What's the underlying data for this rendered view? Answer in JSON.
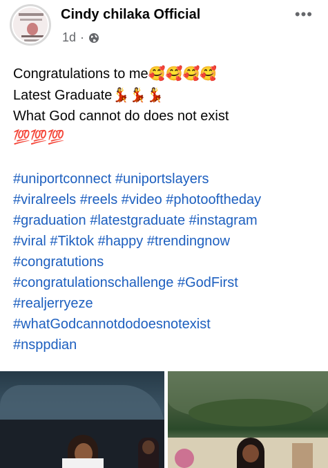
{
  "post": {
    "author": "Cindy chilaka Official",
    "time": "1d",
    "separator": "·",
    "more_label": "•••",
    "lines": [
      {
        "text": "Congratulations to me",
        "emoji": "🥰🥰🥰🥰"
      },
      {
        "text": "Latest Graduate",
        "emoji": "💃💃💃"
      },
      {
        "text": "What God cannot do does not exist",
        "emoji": ""
      },
      {
        "text": "",
        "emoji": "💯💯💯"
      }
    ],
    "hashtags": [
      [
        "#uniportconnect",
        "#uniportslayers"
      ],
      [
        "#viralreels",
        "#reels",
        "#video",
        "#photooftheday"
      ],
      [
        "#graduation",
        "#latestgraduate",
        "#instagram"
      ],
      [
        "#viral",
        "#Tiktok",
        "#happy",
        "#trendingnow"
      ],
      [
        "#congratutions"
      ],
      [
        "#congratulationschallenge",
        "#GodFirst"
      ],
      [
        "#realjerryeze"
      ],
      [
        "#whatGodcannotdodoesnotexist"
      ],
      [
        "#nsppdian"
      ]
    ]
  },
  "colors": {
    "link": "#1d5fbf",
    "secondary_text": "#65676b",
    "primary_text": "#050505"
  },
  "icons": {
    "privacy": "globe-icon",
    "menu": "more-options-icon"
  }
}
